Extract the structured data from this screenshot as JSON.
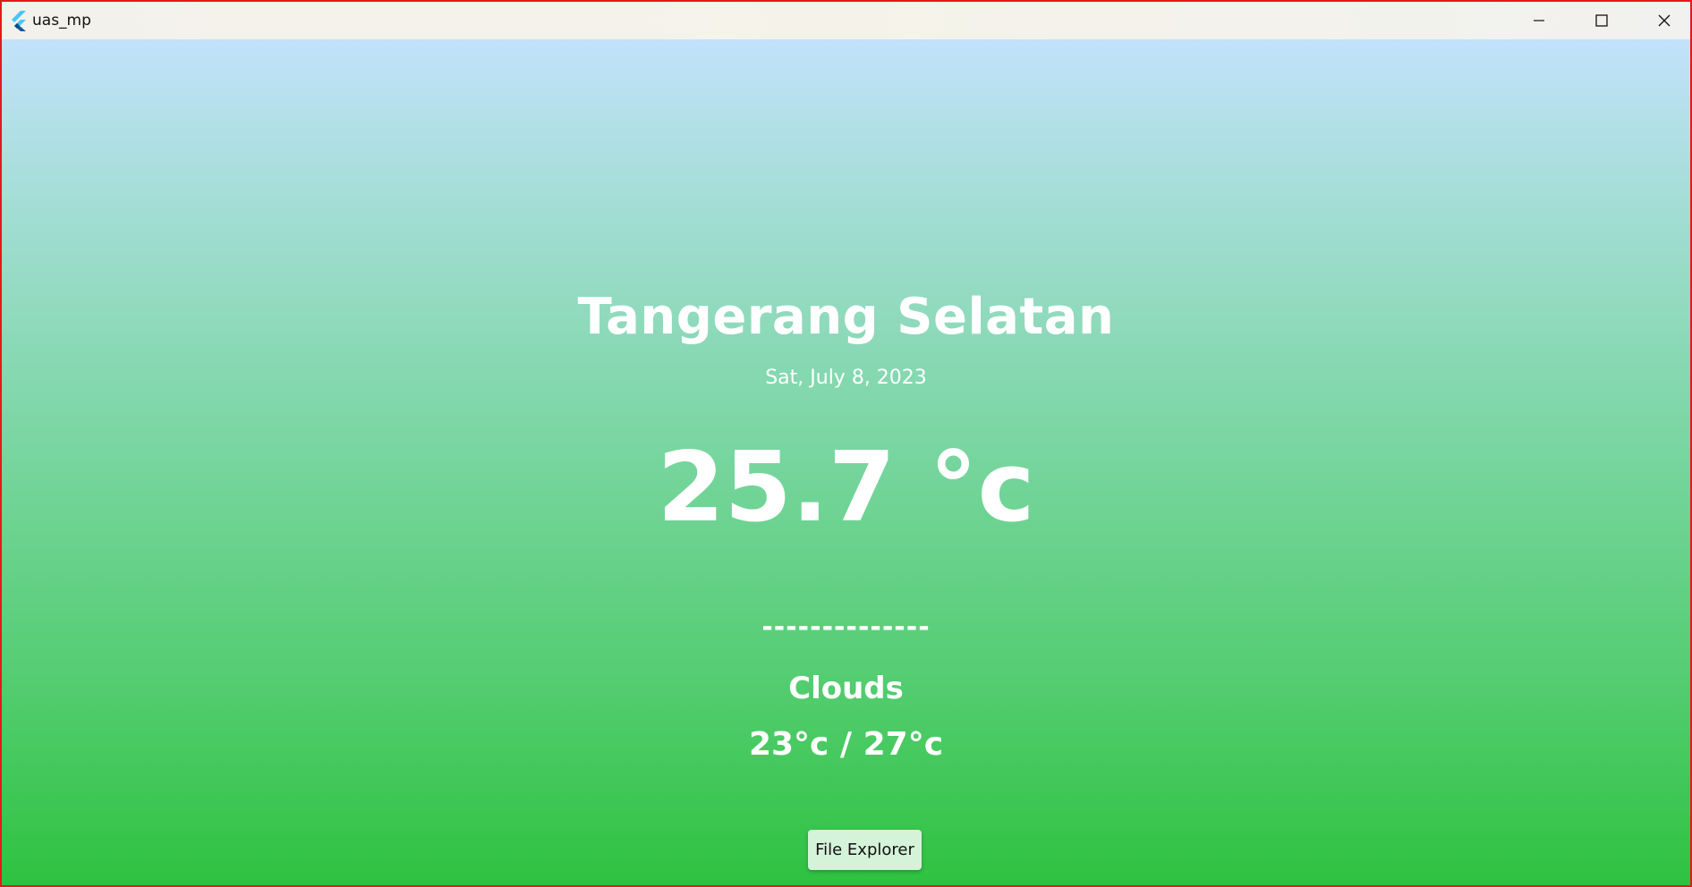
{
  "window": {
    "title": "uas_mp",
    "border_color": "#e01b1b"
  },
  "titlebar": {
    "controls": [
      {
        "icon": "minimize-icon"
      },
      {
        "icon": "maximize-icon"
      },
      {
        "icon": "close-icon"
      }
    ]
  },
  "weather": {
    "city": "Tangerang Selatan",
    "date": "Sat, July 8, 2023",
    "temperature": "25.7 °c",
    "divider": "--------------",
    "condition": "Clouds",
    "range": "23°c / 27°c"
  },
  "actions": {
    "file_explorer_label": "File Explorer"
  },
  "colors": {
    "gradient_top": "#c2e2fb",
    "gradient_bottom": "#2ec240",
    "text": "#ffffff",
    "button_bg": "#d4f3d8"
  }
}
